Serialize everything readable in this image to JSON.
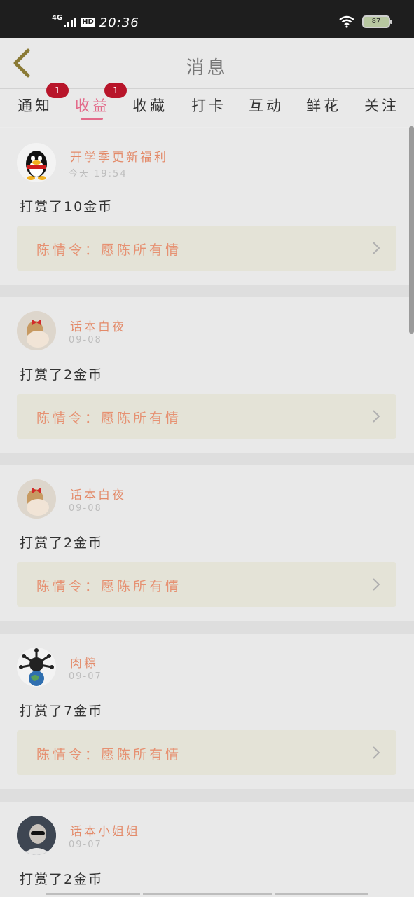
{
  "status_bar": {
    "network": "4G",
    "hd": "HD",
    "time": "20:36",
    "battery": "87"
  },
  "header": {
    "title": "消息"
  },
  "tabs": [
    {
      "label": "通知",
      "badge": "1"
    },
    {
      "label": "收益",
      "badge": "1",
      "active": true
    },
    {
      "label": "收藏"
    },
    {
      "label": "打卡"
    },
    {
      "label": "互动"
    },
    {
      "label": "鲜花"
    },
    {
      "label": "关注"
    }
  ],
  "messages": [
    {
      "avatar": "penguin-avatar",
      "name": "开学季更新福利",
      "date": "今天 19:54",
      "reward": "打赏了10金币",
      "card": "陈情令：愿陈所有情"
    },
    {
      "avatar": "girl-with-bow-avatar",
      "name": "话本白夜",
      "date": "09-08",
      "reward": "打赏了2金币",
      "card": "陈情令：愿陈所有情"
    },
    {
      "avatar": "girl-with-bow-avatar",
      "name": "话本白夜",
      "date": "09-08",
      "reward": "打赏了2金币",
      "card": "陈情令：愿陈所有情"
    },
    {
      "avatar": "virus-earth-avatar",
      "name": "肉粽",
      "date": "09-07",
      "reward": "打赏了7金币",
      "card": "陈情令：愿陈所有情"
    },
    {
      "avatar": "person-sunglasses-avatar",
      "name": "话本小姐姐",
      "date": "09-07",
      "reward": "打赏了2金币"
    }
  ],
  "colors": {
    "accent": "#e36a8a",
    "name": "#e38a69",
    "badge": "#b8152a",
    "card_bg": "#e4e3d7"
  }
}
